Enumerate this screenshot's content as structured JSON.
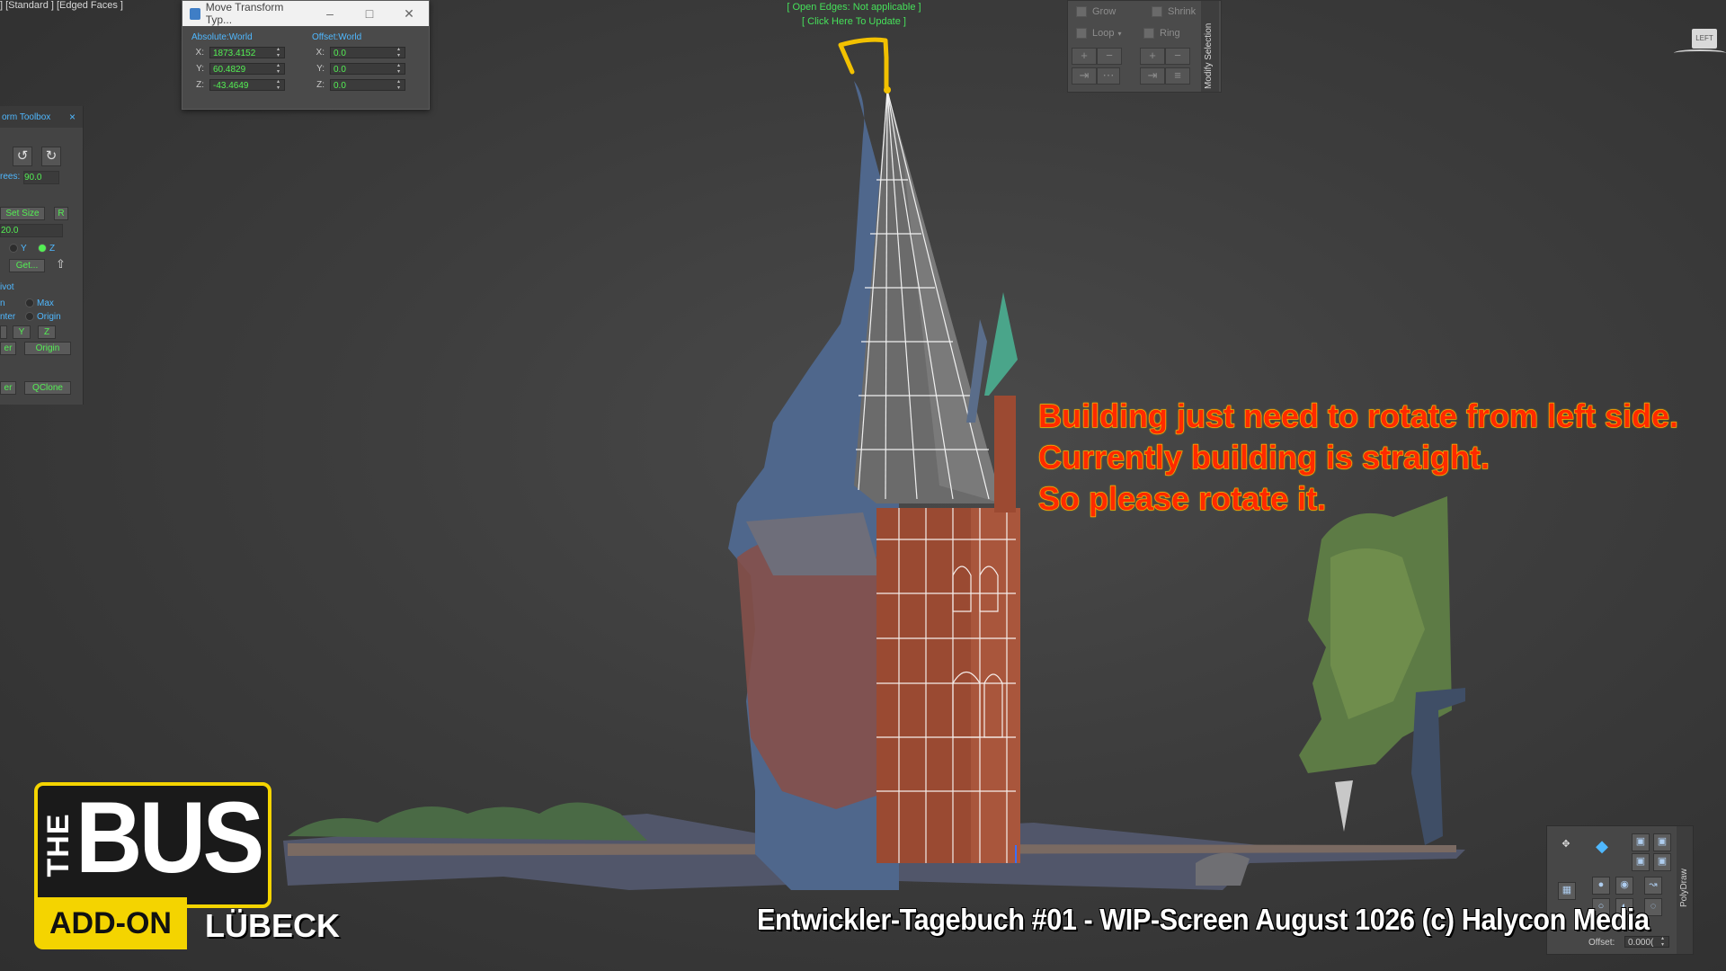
{
  "viewport": {
    "label": "] [Standard ] [Edged Faces ]"
  },
  "top_status": {
    "line1": "[ Open Edges: Not applicable ]",
    "line2": "[ Click Here To Update ]"
  },
  "move_dialog": {
    "title": "Move Transform Typ...",
    "minimize": "–",
    "maximize": "□",
    "close": "✕",
    "absolute": {
      "title": "Absolute:World",
      "x_label": "X:",
      "x": "1873.4152",
      "y_label": "Y:",
      "y": "60.4829",
      "z_label": "Z:",
      "z": "-43.4649"
    },
    "offset": {
      "title": "Offset:World",
      "x_label": "X:",
      "x": "0.0",
      "y_label": "Y:",
      "y": "0.0",
      "z_label": "Z:",
      "z": "0.0"
    }
  },
  "toolbox": {
    "title": "orm Toolbox",
    "close": "×",
    "degrees_label": "rees:",
    "degrees_value": "90.0",
    "set_size": "Set Size",
    "r_button": "R",
    "size_value": "20.0",
    "axis_y": "Y",
    "axis_z": "Z",
    "get_button": "Get...",
    "pivot_title": "ivot",
    "opt_n": "n",
    "opt_max": "Max",
    "opt_nter": "nter",
    "opt_origin": "Origin",
    "btn_y": "Y",
    "btn_z": "Z",
    "btn_ter": "er",
    "btn_origin": "Origin",
    "btn_er": "er",
    "btn_qclone": "QClone"
  },
  "modify_selection": {
    "grow": "Grow",
    "shrink": "Shrink",
    "loop": "Loop",
    "ring": "Ring",
    "side_label": "Modify Selection"
  },
  "viewcube": {
    "label": "LEFT"
  },
  "annotation": {
    "line1": "Building just need to rotate from left side.",
    "line2": "Currently building is straight.",
    "line3": "So please rotate it."
  },
  "caption": {
    "text": "Entwickler-Tagebuch #01 - WIP-Screen August 1026   (c) Halycon Media"
  },
  "polydraw": {
    "side_label": "PolyDraw",
    "offset_label": "Offset:",
    "offset_value": "0.000("
  },
  "logo": {
    "the": "THE",
    "bus": "BUS",
    "addon": "ADD-ON",
    "city": "LÜBECK"
  },
  "colors": {
    "annotation_fill": "#ff2a00",
    "annotation_outline": "#ffb400",
    "logo_yellow": "#f4d400",
    "ui_green": "#54ef54",
    "ui_blue": "#4fb8ff"
  }
}
